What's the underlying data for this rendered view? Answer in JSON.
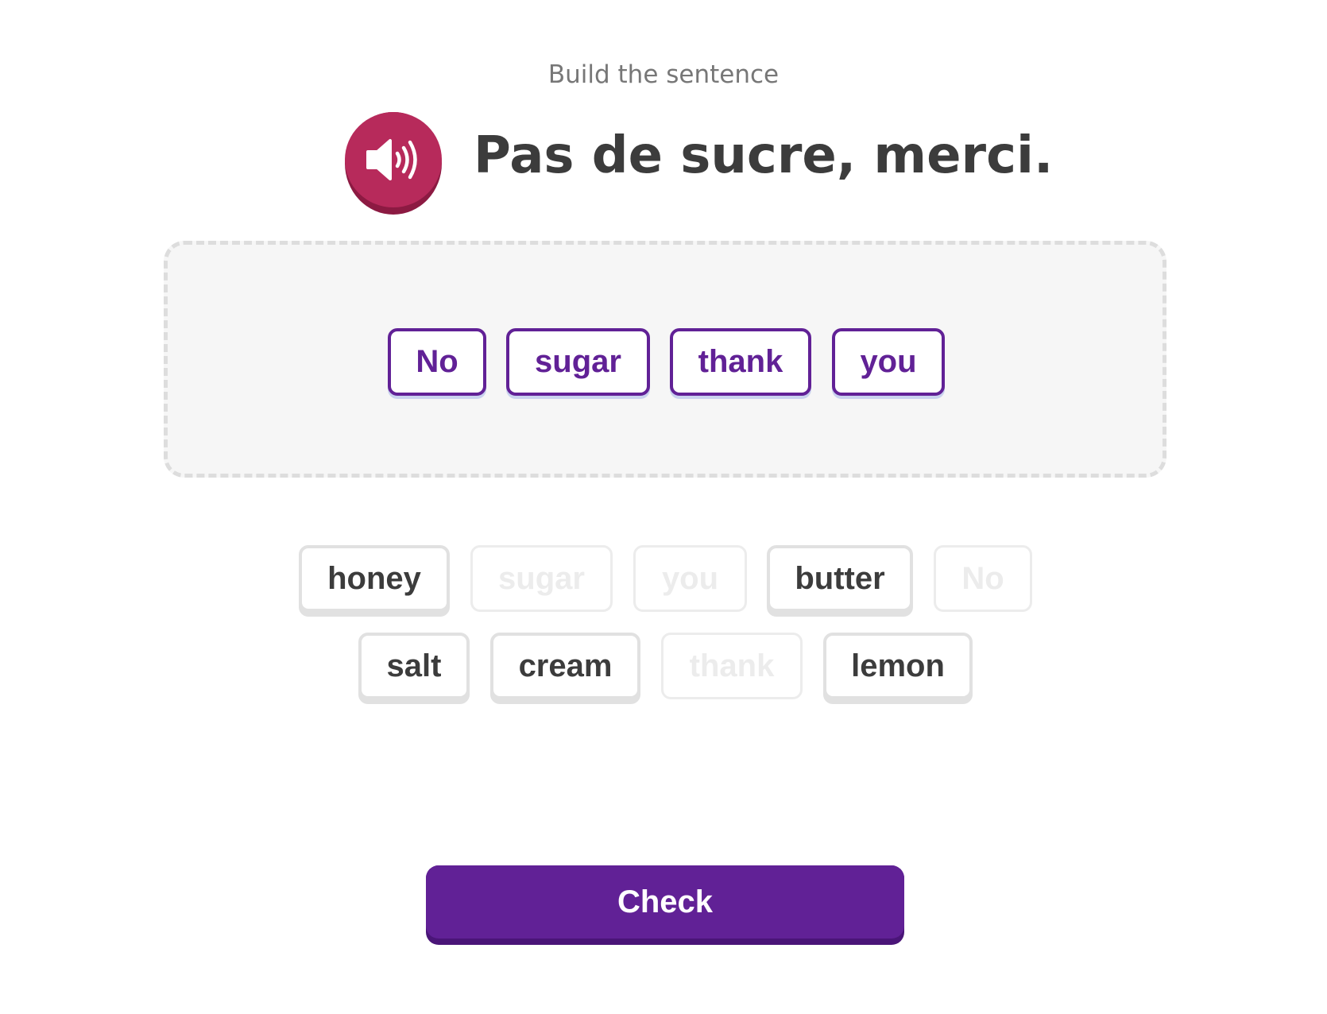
{
  "exercise": {
    "instruction": "Build the sentence",
    "prompt": "Pas de sucre, merci.",
    "audio_icon": "speaker-icon",
    "accent_color": "#612196",
    "audio_button_color": "#b72a5b"
  },
  "answer": {
    "words": [
      "No",
      "sugar",
      "thank",
      "you"
    ]
  },
  "word_bank": {
    "rows": [
      [
        {
          "word": "honey",
          "used": false
        },
        {
          "word": "sugar",
          "used": true
        },
        {
          "word": "you",
          "used": true
        },
        {
          "word": "butter",
          "used": false
        },
        {
          "word": "No",
          "used": true
        }
      ],
      [
        {
          "word": "salt",
          "used": false
        },
        {
          "word": "cream",
          "used": false
        },
        {
          "word": "thank",
          "used": true
        },
        {
          "word": "lemon",
          "used": false
        }
      ]
    ]
  },
  "actions": {
    "check_label": "Check"
  }
}
